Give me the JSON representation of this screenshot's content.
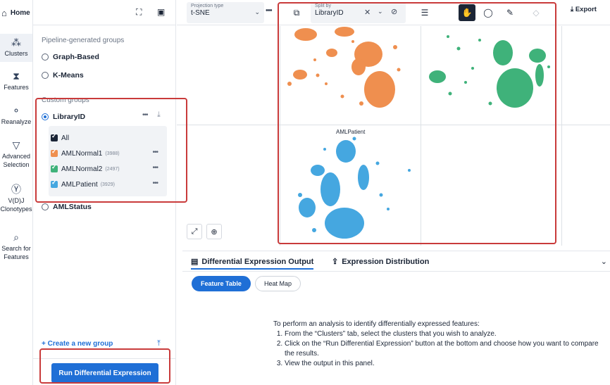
{
  "header": {
    "home_label": "Home"
  },
  "rail": {
    "items": [
      {
        "label": "Clusters"
      },
      {
        "label": "Features"
      },
      {
        "label": "Reanalyze"
      },
      {
        "label": "Advanced Selection"
      },
      {
        "label": "V(D)J Clonotypes"
      },
      {
        "label": "Search for Features"
      }
    ]
  },
  "groups": {
    "pipeline_title": "Pipeline-generated groups",
    "pipeline": [
      {
        "label": "Graph-Based"
      },
      {
        "label": "K-Means"
      }
    ],
    "custom_title": "Custom groups",
    "selected_group": "LibraryID",
    "all_label": "All",
    "members": [
      {
        "label": "AMLNormal1",
        "count": "(3988)",
        "color": "#ef8f4f"
      },
      {
        "label": "AMLNormal2",
        "count": "(2497)",
        "color": "#3fb27a"
      },
      {
        "label": "AMLPatient",
        "count": "(3929)",
        "color": "#45a7e0"
      }
    ],
    "other_group": "AMLStatus",
    "create_link": "+ Create a new group",
    "run_button": "Run Differential Expression"
  },
  "toolbar": {
    "projection_label": "Projection type",
    "projection_value": "t-SNE",
    "split_label": "Split by",
    "split_value": "LibraryID",
    "export_label": "Export"
  },
  "plot": {
    "panel_label": "AMLPatient"
  },
  "output": {
    "tab1": "Differential Expression Output",
    "tab2": "Expression Distribution",
    "pill1": "Feature Table",
    "pill2": "Heat Map",
    "intro": "To perform an analysis to identify differentially expressed features:",
    "steps": [
      "From the “Clusters” tab, select the clusters that you wish to analyze.",
      "Click on the “Run Differential Expression” button at the bottom and choose how you want to compare the results.",
      "View the output in this panel."
    ]
  }
}
